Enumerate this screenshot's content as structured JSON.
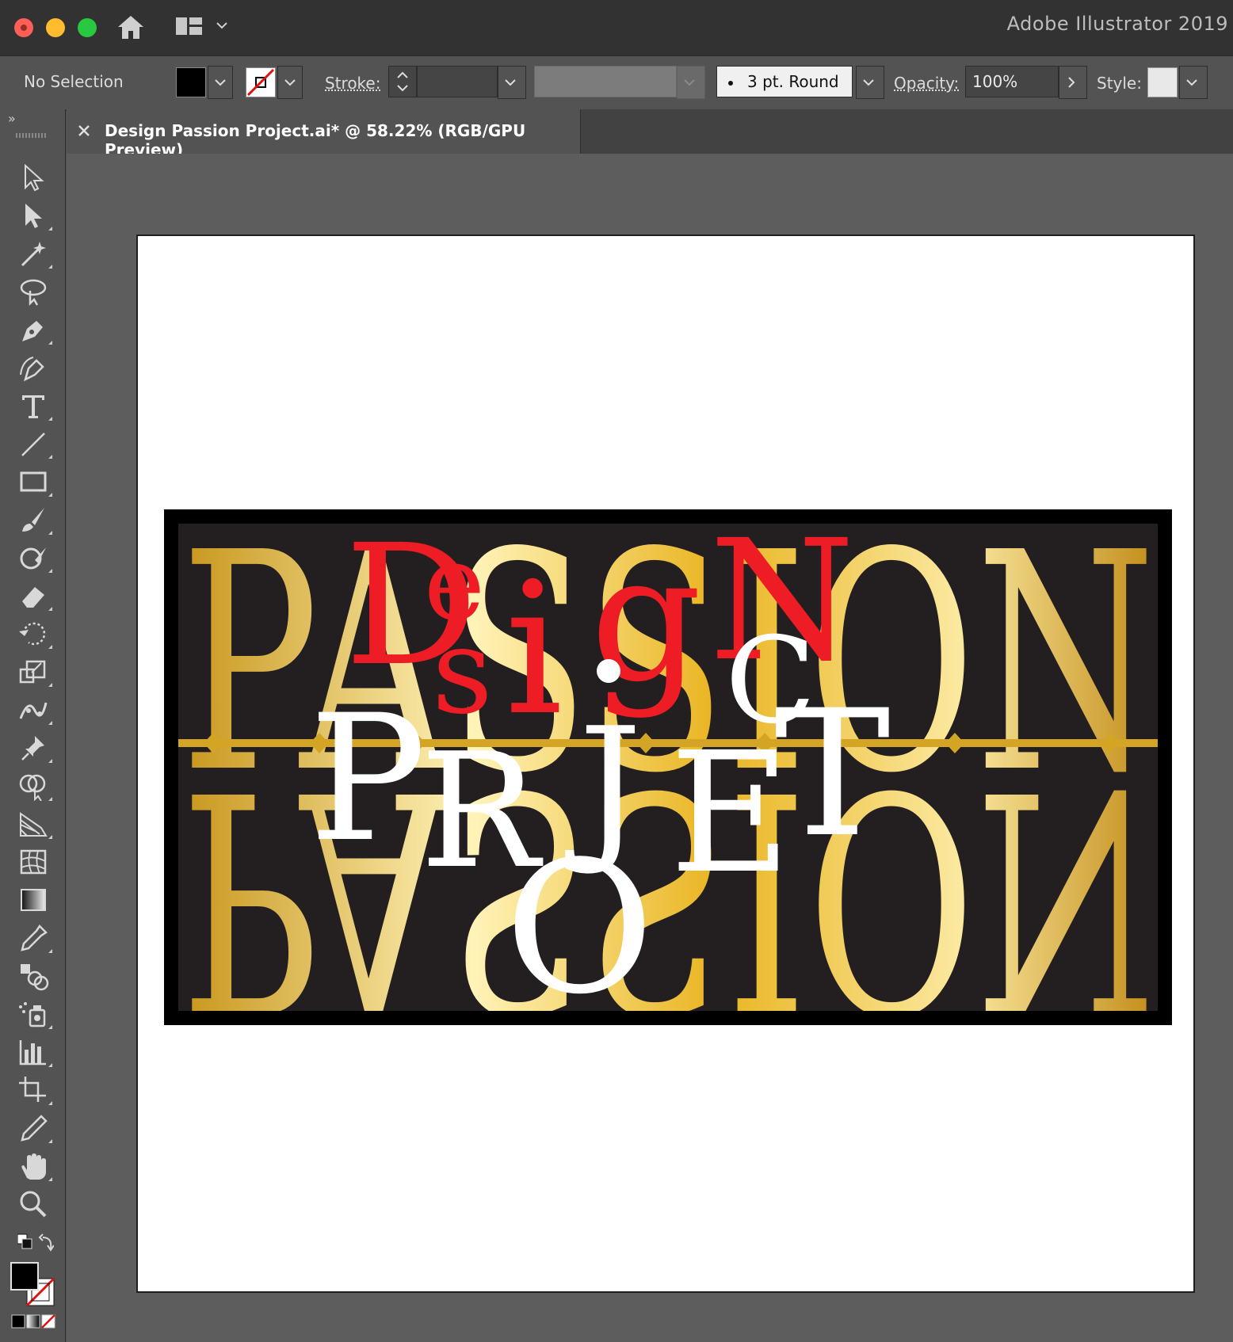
{
  "window": {
    "app_title": "Adobe Illustrator 2019"
  },
  "icons": {
    "home": "home-icon",
    "workspace": "workspace-switcher-icon",
    "close_tab": "close-icon"
  },
  "control_bar": {
    "selection": "No Selection",
    "stroke_label": "Stroke:",
    "brush": "3 pt. Round",
    "opacity_label": "Opacity:",
    "opacity_value": "100%",
    "style_label": "Style:"
  },
  "document": {
    "tab_title": "Design Passion Project.ai* @ 58.22% (RGB/GPU Preview)"
  },
  "artwork": {
    "background_words": [
      "PASSION",
      "PASSION"
    ],
    "red_word": [
      "D",
      "e",
      "s",
      "i",
      "g",
      "N"
    ],
    "white_word": [
      "P",
      "R",
      "O",
      "J",
      "E",
      "C",
      "T"
    ],
    "colors": {
      "gold": "#d4a524",
      "red": "#ee1c25",
      "white": "#ffffff",
      "dark": "#231f20"
    }
  },
  "colors": {
    "chrome_dark": "#323232",
    "chrome": "#535353",
    "canvas": "#5d5d5d"
  }
}
